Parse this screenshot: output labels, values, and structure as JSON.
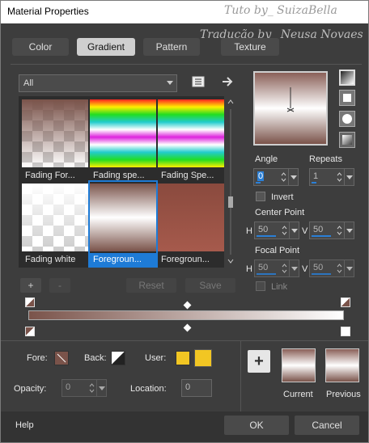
{
  "window": {
    "title": "Material Properties"
  },
  "watermark": {
    "line1": "Tuto by_ SuizaBella",
    "line2": "Tradução by_ Neusa Novaes"
  },
  "tabs": [
    "Color",
    "Gradient",
    "Pattern",
    "Texture"
  ],
  "active_tab": "Gradient",
  "category_dropdown": {
    "value": "All"
  },
  "gallery": {
    "items": [
      {
        "label": "Fading For..."
      },
      {
        "label": "Fading spe..."
      },
      {
        "label": "Fading Spe..."
      },
      {
        "label": "Fading white"
      },
      {
        "label": "Foregroun...",
        "selected": true
      },
      {
        "label": "Foregroun..."
      }
    ]
  },
  "stop_buttons": {
    "add": "+",
    "remove": "-",
    "reset": "Reset",
    "save": "Save"
  },
  "angle": {
    "label": "Angle",
    "value": "0"
  },
  "repeats": {
    "label": "Repeats",
    "value": "1"
  },
  "invert": {
    "label": "Invert",
    "checked": false
  },
  "center_point": {
    "label": "Center Point",
    "h_label": "H",
    "h": "50",
    "v_label": "V",
    "v": "50"
  },
  "focal_point": {
    "label": "Focal Point",
    "h_label": "H",
    "h": "50",
    "v_label": "V",
    "v": "50"
  },
  "link": {
    "label": "Link",
    "checked": false
  },
  "bottom": {
    "fore_label": "Fore:",
    "back_label": "Back:",
    "user_label": "User:",
    "opacity_label": "Opacity:",
    "opacity_value": "0",
    "location_label": "Location:",
    "location_value": "0",
    "add_button": "+",
    "current_label": "Current",
    "previous_label": "Previous"
  },
  "footer": {
    "help": "Help",
    "ok": "OK",
    "cancel": "Cancel"
  },
  "colors": {
    "gradient_dark": "#7a534a",
    "gradient_light": "#ffffff",
    "selection_blue": "#1e7bd6",
    "user_swatch": "#f2c623"
  }
}
